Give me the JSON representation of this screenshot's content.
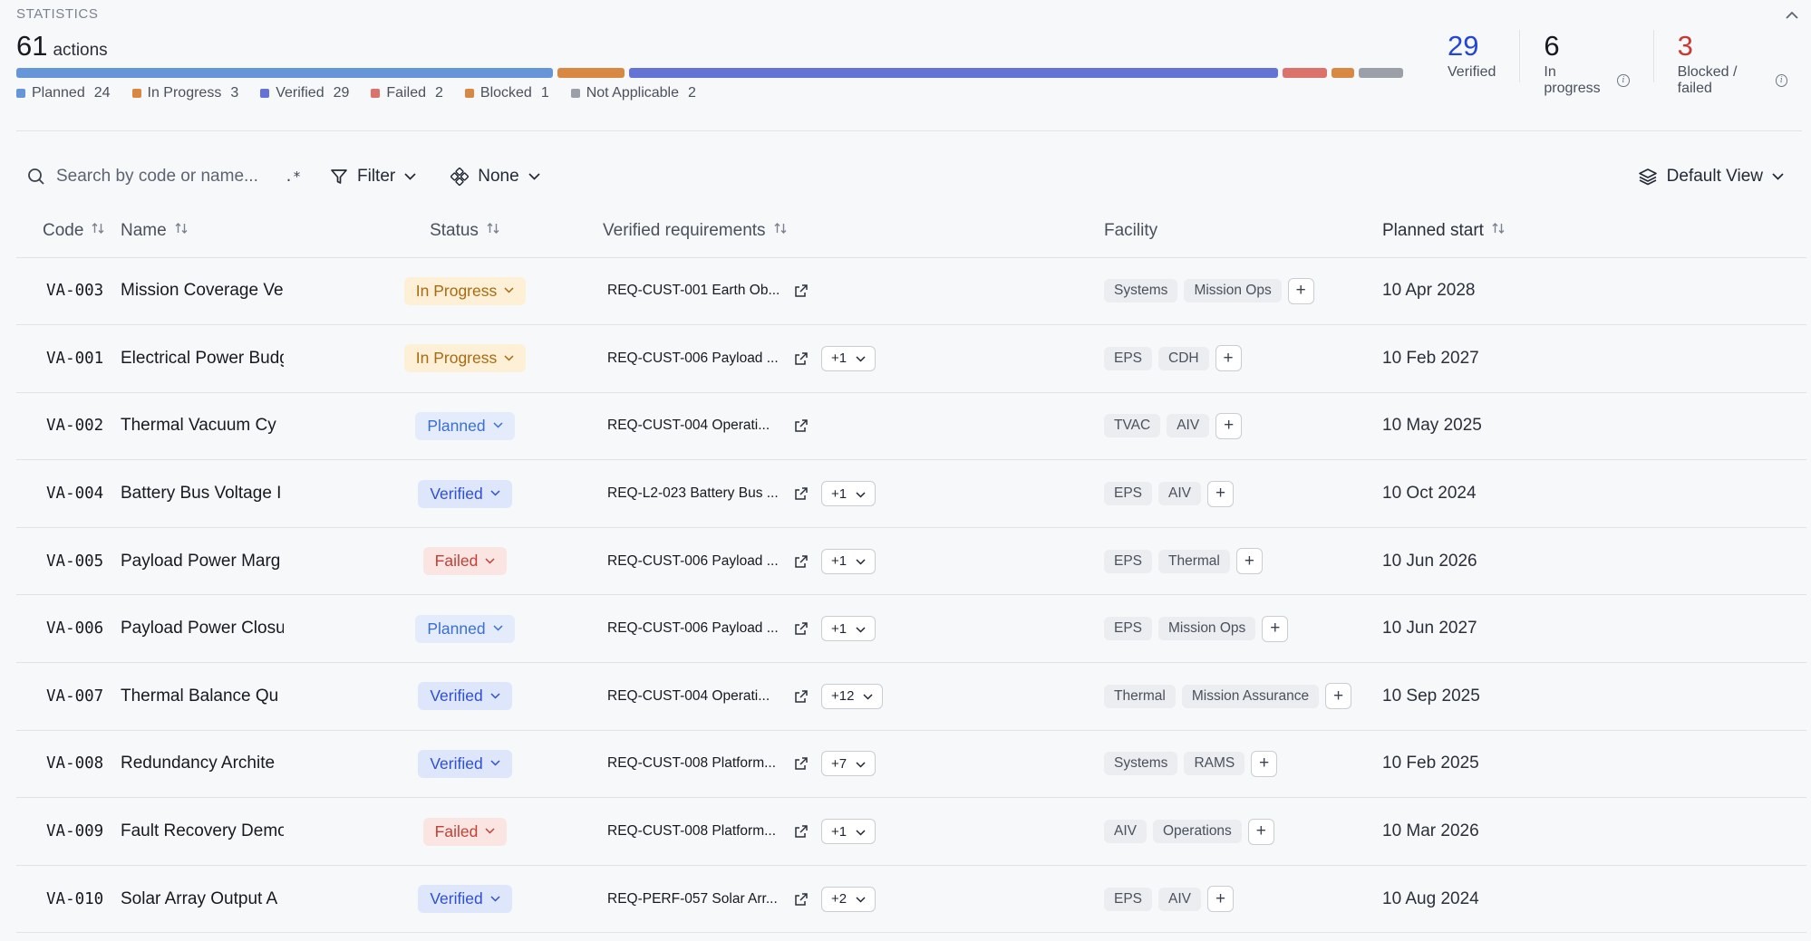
{
  "stats": {
    "label": "STATISTICS",
    "total": "61",
    "total_label": "actions",
    "bar": [
      {
        "name": "Planned",
        "value": 24,
        "color": "#6796d8"
      },
      {
        "name": "In Progress",
        "value": 3,
        "color": "#d98843"
      },
      {
        "name": "Verified",
        "value": 29,
        "color": "#6473d6"
      },
      {
        "name": "Failed",
        "value": 2,
        "color": "#db736c"
      },
      {
        "name": "Blocked",
        "value": 1,
        "color": "#d98843"
      },
      {
        "name": "Not Applicable",
        "value": 2,
        "color": "#9ba0a8"
      }
    ],
    "legend": [
      {
        "label": "Planned",
        "value": "24",
        "color": "#6796d8"
      },
      {
        "label": "In Progress",
        "value": "3",
        "color": "#d98843"
      },
      {
        "label": "Verified",
        "value": "29",
        "color": "#6473d6"
      },
      {
        "label": "Failed",
        "value": "2",
        "color": "#db736c"
      },
      {
        "label": "Blocked",
        "value": "1",
        "color": "#d98843"
      },
      {
        "label": "Not Applicable",
        "value": "2",
        "color": "#9ba0a8"
      }
    ],
    "kpis": [
      {
        "value": "29",
        "label": "Verified",
        "color": "#2346d6",
        "info": false
      },
      {
        "value": "6",
        "label": "In progress",
        "color": "#16191f",
        "info": true
      },
      {
        "value": "3",
        "label": "Blocked / failed",
        "color": "#c83a30",
        "info": true
      }
    ]
  },
  "toolbar": {
    "search_placeholder": "Search by code or name...",
    "regex_label": ".*",
    "filter_label": "Filter",
    "group_label": "None",
    "view_label": "Default View"
  },
  "columns": {
    "code": "Code",
    "name": "Name",
    "status": "Status",
    "requirements": "Verified requirements",
    "facility": "Facility",
    "planned_start": "Planned start"
  },
  "status_styles": {
    "In Progress": {
      "bg": "#fdf0d6",
      "fg": "#a86a12"
    },
    "Planned": {
      "bg": "#e4ecfb",
      "fg": "#3a6fd1"
    },
    "Verified": {
      "bg": "#dde6fb",
      "fg": "#2f4fd0"
    },
    "Failed": {
      "bg": "#fbe5e3",
      "fg": "#c24036"
    }
  },
  "rows": [
    {
      "code": "VA-003",
      "name": "Mission Coverage Ve",
      "status": "In Progress",
      "req": "REQ-CUST-001 Earth Ob...",
      "more": "",
      "facility": [
        "Systems",
        "Mission Ops"
      ],
      "start": "10 Apr 2028"
    },
    {
      "code": "VA-001",
      "name": "Electrical Power Budg",
      "status": "In Progress",
      "req": "REQ-CUST-006 Payload ...",
      "more": "+1",
      "facility": [
        "EPS",
        "CDH"
      ],
      "start": "10 Feb 2027"
    },
    {
      "code": "VA-002",
      "name": "Thermal Vacuum Cy",
      "status": "Planned",
      "req": "REQ-CUST-004 Operati...",
      "more": "",
      "facility": [
        "TVAC",
        "AIV"
      ],
      "start": "10 May 2025"
    },
    {
      "code": "VA-004",
      "name": "Battery Bus Voltage I",
      "status": "Verified",
      "req": "REQ-L2-023 Battery Bus ...",
      "more": "+1",
      "facility": [
        "EPS",
        "AIV"
      ],
      "start": "10 Oct 2024"
    },
    {
      "code": "VA-005",
      "name": "Payload Power Marg",
      "status": "Failed",
      "req": "REQ-CUST-006 Payload ...",
      "more": "+1",
      "facility": [
        "EPS",
        "Thermal"
      ],
      "start": "10 Jun 2026"
    },
    {
      "code": "VA-006",
      "name": "Payload Power Closu",
      "status": "Planned",
      "req": "REQ-CUST-006 Payload ...",
      "more": "+1",
      "facility": [
        "EPS",
        "Mission Ops"
      ],
      "start": "10 Jun 2027"
    },
    {
      "code": "VA-007",
      "name": "Thermal Balance Qu",
      "status": "Verified",
      "req": "REQ-CUST-004 Operati...",
      "more": "+12",
      "facility": [
        "Thermal",
        "Mission Assurance"
      ],
      "start": "10 Sep 2025"
    },
    {
      "code": "VA-008",
      "name": "Redundancy Archite",
      "status": "Verified",
      "req": "REQ-CUST-008 Platform...",
      "more": "+7",
      "facility": [
        "Systems",
        "RAMS"
      ],
      "start": "10 Feb 2025"
    },
    {
      "code": "VA-009",
      "name": "Fault Recovery Demo",
      "status": "Failed",
      "req": "REQ-CUST-008 Platform...",
      "more": "+1",
      "facility": [
        "AIV",
        "Operations"
      ],
      "start": "10 Mar 2026"
    },
    {
      "code": "VA-010",
      "name": "Solar Array Output A",
      "status": "Verified",
      "req": "REQ-PERF-057 Solar Arr...",
      "more": "+2",
      "facility": [
        "EPS",
        "AIV"
      ],
      "start": "10 Aug 2024"
    }
  ]
}
